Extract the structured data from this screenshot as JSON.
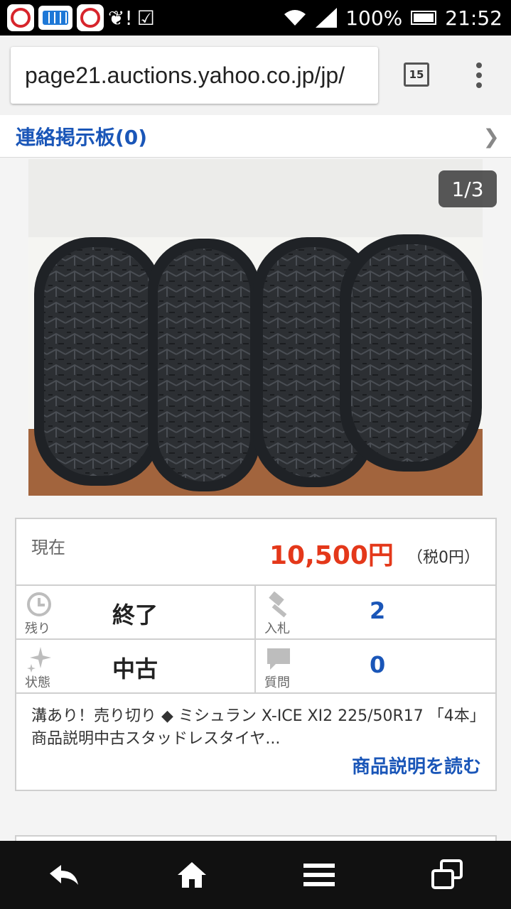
{
  "status_bar": {
    "wifi_icon": "wifi-icon",
    "signal_icon": "signal-icon",
    "battery_percent": "100%",
    "time": "21:52"
  },
  "browser": {
    "url": "page21.auctions.yahoo.co.jp/jp/",
    "tab_count": "15",
    "menu_icon": "overflow-menu-icon"
  },
  "message_board": {
    "label": "連絡掲示板(0)"
  },
  "gallery": {
    "counter": "1/3"
  },
  "auction": {
    "current_label": "現在",
    "price": "10,500円",
    "tax": "（税0円）",
    "remaining_label": "残り",
    "remaining_value": "終了",
    "bids_label": "入札",
    "bids_value": "2",
    "condition_label": "状態",
    "condition_value": "中古",
    "questions_label": "質問",
    "questions_value": "0",
    "description": "溝あり！売り切り ◆ ミシュラン X-ICE XI2 225/50R17 「4本」商品説明中古スタッドレスタイヤ...",
    "read_more": "商品説明を読む"
  },
  "colors": {
    "link_blue": "#1a56b8",
    "price_red": "#e4381a"
  }
}
